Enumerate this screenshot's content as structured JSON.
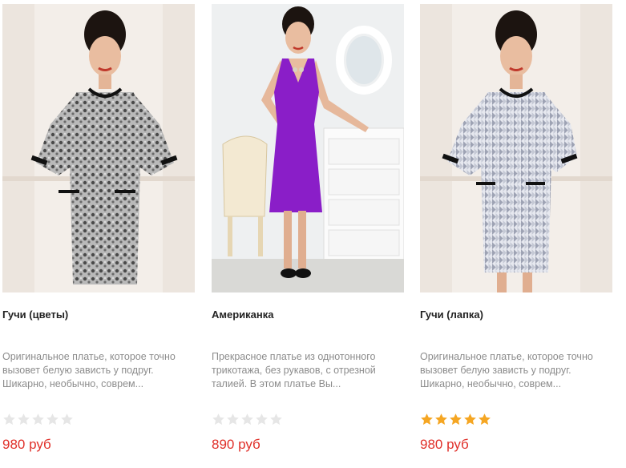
{
  "colors": {
    "price": "#e0302a",
    "star_filled": "#f5a623",
    "star_empty": "#e6e6e6"
  },
  "products": [
    {
      "title": "Гучи (цветы)",
      "description": "Оригинальное платье, которое точно вызовет белую зависть у подруг. Шикарно, необычно, соврем...",
      "rating": 0,
      "max_rating": 5,
      "price": "980 руб",
      "image": "model-lace-print-dress"
    },
    {
      "title": "Американка",
      "description": "Прекрасное платье из однотонного трикотажа, без рукавов, с отрезной талией. В этом платье Вы...",
      "rating": 0,
      "max_rating": 5,
      "price": "890 руб",
      "image": "model-purple-sleeveless-dress"
    },
    {
      "title": "Гучи (лапка)",
      "description": "Оригинальное платье, которое точно вызовет белую зависть у подруг. Шикарно, необычно, соврем...",
      "rating": 5,
      "max_rating": 5,
      "price": "980 руб",
      "image": "model-houndstooth-dress"
    }
  ]
}
